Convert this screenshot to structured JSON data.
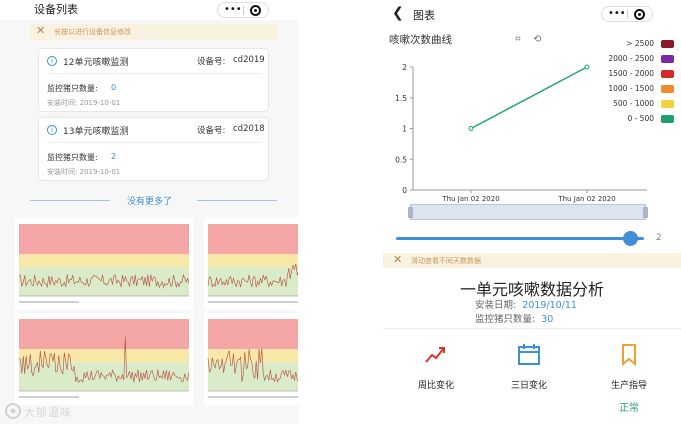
{
  "left": {
    "title": "设备列表",
    "notice": "长按以进行设备信息修改",
    "cards": [
      {
        "name": "12单元咳嗽监测",
        "device_label": "设备号:",
        "device_id": "cd2019",
        "count_label": "监控猪只数量:",
        "count": "0",
        "install_date": "安装时间: 2019-10-01"
      },
      {
        "name": "13单元咳嗽监测",
        "device_label": "设备号:",
        "device_id": "cd2018",
        "count_label": "监控猪只数量:",
        "count": "2",
        "install_date": "安装时间: 2019-10-01"
      }
    ],
    "no_more": "没有更多了",
    "watermark": "大部温味"
  },
  "right": {
    "title": "图表",
    "chart_title": "咳嗽次数曲线",
    "notice": "滑动查看不同天数数据",
    "range_value": "2",
    "report_title": "一单元咳嗽数据分析",
    "install_label": "安装日期:",
    "install_value": "2019/10/11",
    "count_label": "监控猪只数量:",
    "count_value": "30",
    "actions": [
      {
        "label": "周比变化",
        "icon": "trend-icon"
      },
      {
        "label": "三日变化",
        "icon": "calendar-icon"
      },
      {
        "label": "生产指导",
        "icon": "bookmark-icon"
      }
    ],
    "status": "正常"
  },
  "chart_data": {
    "type": "line",
    "title": "咳嗽次数曲线",
    "x": [
      "Thu Jan 02 2020",
      "Thu Jan 02 2020"
    ],
    "y": [
      1,
      2
    ],
    "yticks": [
      "0",
      "0.5",
      "1",
      "1.5",
      "2"
    ],
    "ylim": [
      0,
      2
    ],
    "legend": [
      {
        "label": "> 2500",
        "color": "#8b1a2a"
      },
      {
        "label": "2000 - 2500",
        "color": "#7a2aa8"
      },
      {
        "label": "1500 - 2000",
        "color": "#d42a2a"
      },
      {
        "label": "1000 - 1500",
        "color": "#f08a30"
      },
      {
        "label": "500 - 1000",
        "color": "#f2d040"
      },
      {
        "label": "0 - 500",
        "color": "#1f9e6e"
      }
    ],
    "legend_position": "top-right",
    "line_color": "#2aa37a"
  }
}
